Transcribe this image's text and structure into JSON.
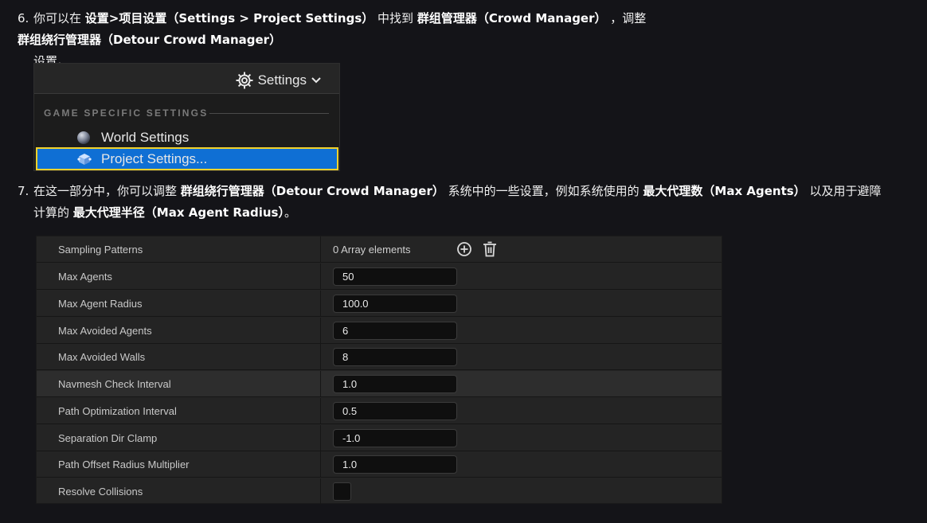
{
  "step6": {
    "num": "6.",
    "t1": "你可以在 ",
    "b1": "设置>项目设置（Settings > Project Settings）",
    "t2": " 中找到 ",
    "b2": "群组管理器（Crowd Manager）",
    "t3": " ，调整 ",
    "b3": "群组绕行管理器（Detour Crowd Manager）",
    "t4": "设置。"
  },
  "menu": {
    "settings_label": "Settings",
    "section_title": "GAME SPECIFIC SETTINGS",
    "items": [
      {
        "label": "World Settings",
        "icon": "globe-icon"
      },
      {
        "label": "Project Settings...",
        "icon": "project-cube-icon",
        "highlighted": true
      }
    ]
  },
  "step7": {
    "num": "7.",
    "t1": "在这一部分中，你可以调整 ",
    "b1": "群组绕行管理器（Detour Crowd Manager）",
    "t2": " 系统中的一些设置，例如系统使用的 ",
    "b2": "最大代理数（Max Agents）",
    "t3": " 以及用于避障",
    "t4": "计算的 ",
    "b3": "最大代理半径（Max Agent Radius）",
    "t5": "。"
  },
  "properties": {
    "array_row": {
      "name": "Sampling Patterns",
      "value": "0 Array elements"
    },
    "rows": [
      {
        "name": "Max Agents",
        "value": "50"
      },
      {
        "name": "Max Agent Radius",
        "value": "100.0"
      },
      {
        "name": "Max Avoided Agents",
        "value": "6"
      },
      {
        "name": "Max Avoided Walls",
        "value": "8"
      },
      {
        "name": "Navmesh Check Interval",
        "value": "1.0"
      },
      {
        "name": "Path Optimization Interval",
        "value": "0.5"
      },
      {
        "name": "Separation Dir Clamp",
        "value": "-1.0"
      },
      {
        "name": "Path Offset Radius Multiplier",
        "value": "1.0"
      }
    ],
    "checkbox_row": {
      "name": "Resolve Collisions",
      "checked": false
    }
  },
  "colors": {
    "background": "#141418",
    "highlight": "#0f6fd4",
    "highlight_border": "#f2d22b"
  }
}
